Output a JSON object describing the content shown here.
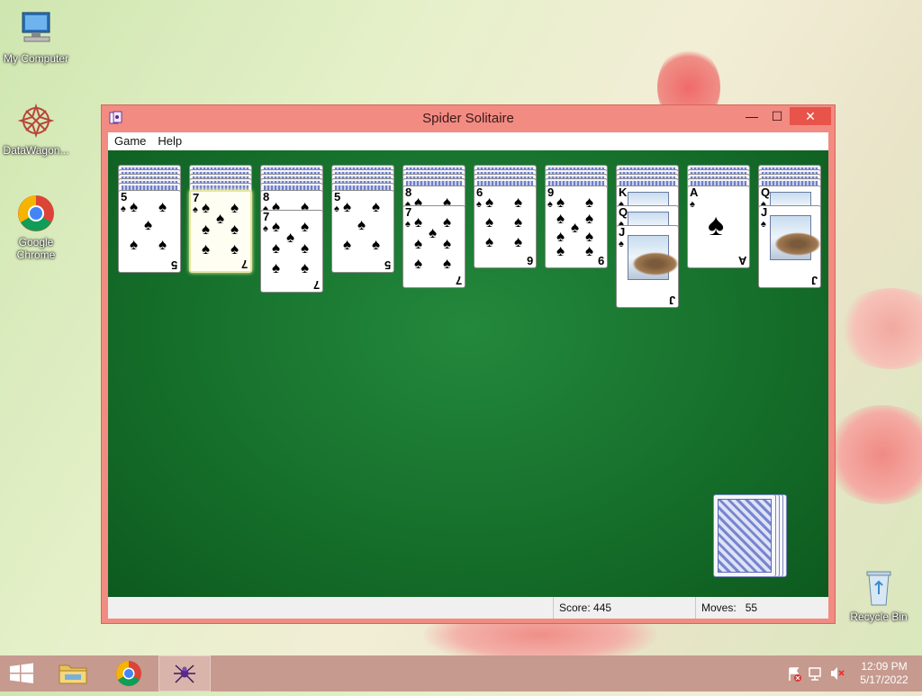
{
  "desktop": {
    "icons": [
      {
        "label": "My Computer",
        "icon": "computer-icon"
      },
      {
        "label": "DataWagon...",
        "icon": "datawagon-icon"
      },
      {
        "label": "Google Chrome",
        "icon": "chrome-icon"
      },
      {
        "label": "Recycle Bin",
        "icon": "recycle-bin-icon"
      }
    ]
  },
  "window": {
    "title": "Spider Solitaire",
    "menu": [
      "Game",
      "Help"
    ],
    "controls": {
      "minimize": "—",
      "maximize": "☐",
      "close": "✕"
    }
  },
  "game": {
    "columns": [
      {
        "hidden": 5,
        "cards": [
          {
            "rank": "5",
            "suit": "♠"
          }
        ]
      },
      {
        "hidden": 5,
        "cards": [
          {
            "rank": "7",
            "suit": "♠",
            "selected": true
          }
        ]
      },
      {
        "hidden": 5,
        "cards": [
          {
            "rank": "8",
            "suit": "♠"
          },
          {
            "rank": "7",
            "suit": "♠"
          }
        ]
      },
      {
        "hidden": 5,
        "cards": [
          {
            "rank": "5",
            "suit": "♠"
          }
        ]
      },
      {
        "hidden": 4,
        "cards": [
          {
            "rank": "8",
            "suit": "♠"
          },
          {
            "rank": "7",
            "suit": "♠"
          }
        ]
      },
      {
        "hidden": 4,
        "cards": [
          {
            "rank": "6",
            "suit": "♠"
          }
        ]
      },
      {
        "hidden": 4,
        "cards": [
          {
            "rank": "9",
            "suit": "♠"
          }
        ]
      },
      {
        "hidden": 4,
        "cards": [
          {
            "rank": "K",
            "suit": "♠"
          },
          {
            "rank": "Q",
            "suit": "♠"
          },
          {
            "rank": "J",
            "suit": "♠"
          }
        ]
      },
      {
        "hidden": 4,
        "cards": [
          {
            "rank": "A",
            "suit": "♠"
          }
        ]
      },
      {
        "hidden": 4,
        "cards": [
          {
            "rank": "Q",
            "suit": "♠"
          },
          {
            "rank": "J",
            "suit": "♠"
          }
        ]
      }
    ],
    "stock_deals": 4
  },
  "status": {
    "score_label": "Score: 445",
    "moves_label": "Moves:",
    "moves_value": "55"
  },
  "taskbar": {
    "items": [
      "start-icon",
      "file-explorer-icon",
      "chrome-icon",
      "spider-solitaire-icon"
    ],
    "tray_icons": [
      "action-center-flag-icon",
      "network-icon",
      "volume-muted-icon"
    ],
    "time": "12:09 PM",
    "date": "5/17/2022"
  },
  "colors": {
    "window_frame": "#f28b82",
    "close_button": "#e8544a",
    "felt": "#16702b",
    "taskbar": "#c69a8f"
  }
}
